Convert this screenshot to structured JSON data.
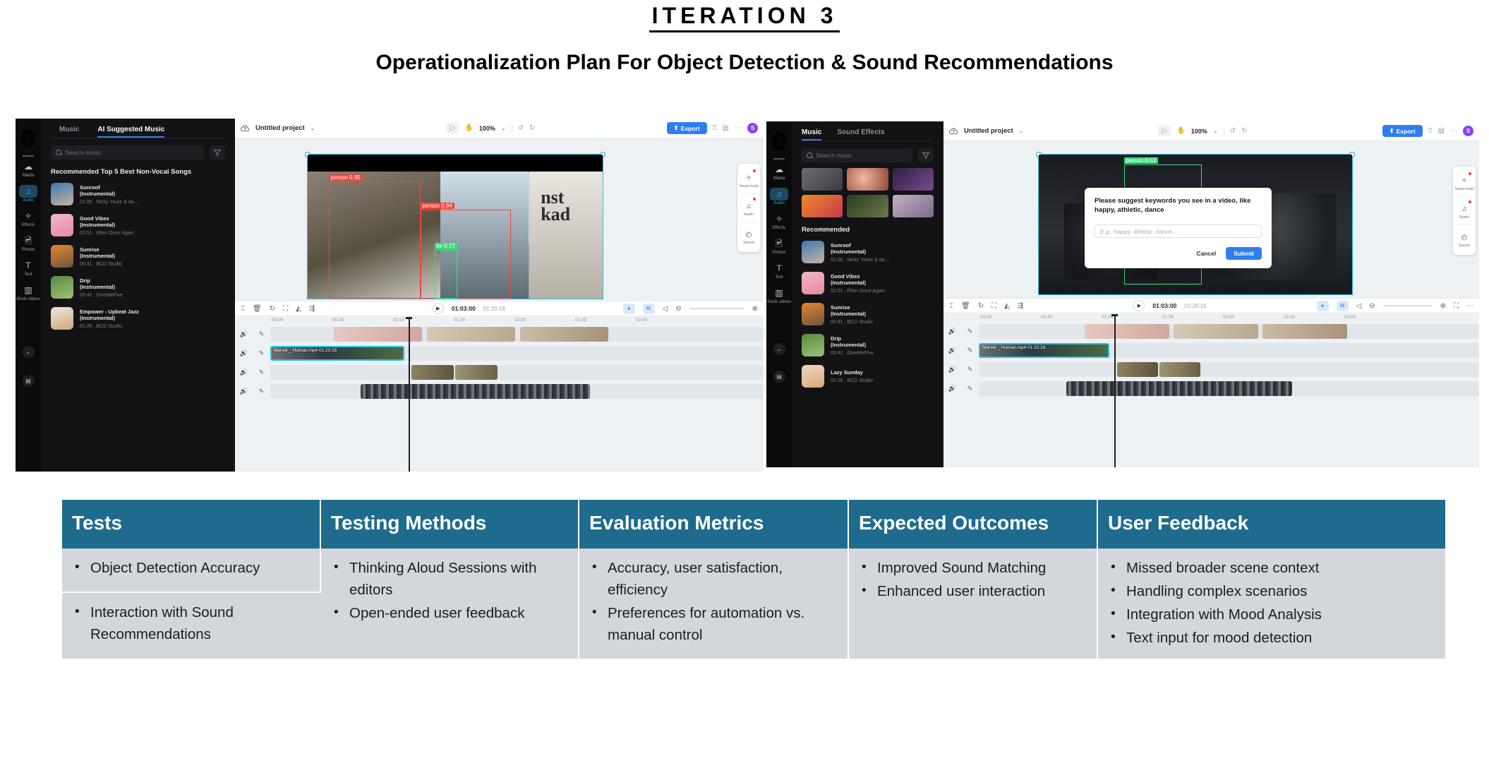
{
  "header": {
    "iteration_title": "ITERATION 3",
    "subtitle": "Operationalization Plan For Object Detection & Sound Recommendations"
  },
  "editor_left": {
    "nav": [
      {
        "label": "Media",
        "icon": "cloud-icon",
        "active": false
      },
      {
        "label": "Audio",
        "icon": "music-note-icon",
        "active": true
      },
      {
        "label": "Effects",
        "icon": "sparkle-icon",
        "active": false
      },
      {
        "label": "Photos",
        "icon": "image-icon",
        "active": false
      },
      {
        "label": "Text",
        "icon": "text-icon",
        "active": false
      },
      {
        "label": "Stock videos",
        "icon": "film-icon",
        "active": false
      }
    ],
    "tabs": [
      {
        "label": "Music",
        "active": false
      },
      {
        "label": "AI Suggested Music",
        "active": true
      }
    ],
    "search_placeholder": "Search music",
    "section_title": "Recommended Top 5 Best Non-Vocal Songs",
    "tracks": [
      {
        "title": "Sunroof (Instrumental)",
        "meta": "01:00 . Nicky Youre & da...",
        "c1": "#3f79b8",
        "c2": "#c7b49b"
      },
      {
        "title": "Good Vibes (Instrumental)",
        "meta": "02:51 . Ellen Once Again",
        "c1": "#f0b9c8",
        "c2": "#e5889f"
      },
      {
        "title": "Sunrise (Instrumental)",
        "meta": "00:31 . BCD Studio",
        "c1": "#e8872f",
        "c2": "#6b5440"
      },
      {
        "title": "Drip (Instrumental)",
        "meta": "00:42 . GiveMeFive",
        "c1": "#5c8a3f",
        "c2": "#9cc27a"
      },
      {
        "title": "Empower - Upbeat Jazz (Instrumental)",
        "meta": "01:26 . BCD Studio",
        "c1": "#efe6dc",
        "c2": "#cfa87e"
      }
    ],
    "header_bar": {
      "project_name": "Untitled project",
      "zoom": "100%",
      "export_label": "Export",
      "avatar_initial": "S"
    },
    "detections": [
      {
        "label": "person  0.95",
        "color": "#f2463a"
      },
      {
        "label": "person  0.94",
        "color": "#f2463a"
      },
      {
        "label": "tie  0.77",
        "color": "#3ddc7e"
      }
    ],
    "playbar": {
      "current": "01:03:00",
      "total": "01:20:16"
    },
    "ruler": [
      "00:00",
      "00:30",
      "01:00",
      "01:30",
      "02:00",
      "02:30",
      "03:00"
    ],
    "clip_label": "Marvel _ Human.mp4    01:20:16",
    "right_tools": [
      {
        "label": "Smart tools",
        "icon": "magic-wand-icon",
        "badge": true
      },
      {
        "label": "Audio",
        "icon": "music-note-icon",
        "badge": true
      },
      {
        "label": "Speed",
        "icon": "speedometer-icon",
        "badge": false
      }
    ]
  },
  "editor_right": {
    "nav": [
      {
        "label": "Media",
        "icon": "cloud-icon",
        "active": false
      },
      {
        "label": "Audio",
        "icon": "music-note-icon",
        "active": true
      },
      {
        "label": "Effects",
        "icon": "sparkle-icon",
        "active": false
      },
      {
        "label": "Photos",
        "icon": "image-icon",
        "active": false
      },
      {
        "label": "Text",
        "icon": "text-icon",
        "active": false
      },
      {
        "label": "Stock videos",
        "icon": "film-icon",
        "active": false
      }
    ],
    "tabs": [
      {
        "label": "Music",
        "active": true
      },
      {
        "label": "Sound Effects",
        "active": false
      }
    ],
    "search_placeholder": "Search music",
    "section_title": "Recommended",
    "tracks": [
      {
        "title": "Sunroof (Instrumental)",
        "meta": "01:00 . Nicky Youre & da...",
        "c1": "#3f79b8",
        "c2": "#c7b49b"
      },
      {
        "title": "Good Vibes (Instrumental)",
        "meta": "02:51 . Ellen Once Again",
        "c1": "#f0b9c8",
        "c2": "#e5889f"
      },
      {
        "title": "Sunrise (Instrumental)",
        "meta": "00:31 . BCD Studio",
        "c1": "#e8872f",
        "c2": "#6b5440"
      },
      {
        "title": "Drip (Instrumental)",
        "meta": "00:42 . GiveMeFive",
        "c1": "#5c8a3f",
        "c2": "#9cc27a"
      },
      {
        "title": "Lazy Sunday",
        "meta": "01:26 . BCD Studio",
        "c1": "#f0d8c0",
        "c2": "#d8a878"
      }
    ],
    "header_bar": {
      "project_name": "Untitled project",
      "zoom": "100%",
      "export_label": "Export",
      "avatar_initial": "S"
    },
    "detections": [
      {
        "label": "person  0.53",
        "color": "#3ddc7e"
      }
    ],
    "dialog": {
      "prompt": "Please suggest keywords you see in a video, like happy, athletic, dance",
      "input_placeholder": "E.g., happy, athletic, dance...",
      "cancel_label": "Cancel",
      "submit_label": "Submit"
    },
    "playbar": {
      "current": "01:03:00",
      "total": "01:20:16"
    },
    "ruler": [
      "00:00",
      "00:30",
      "01:00",
      "01:30",
      "02:00",
      "02:30",
      "03:00"
    ],
    "clip_label": "Marvel _ Human.mp4    01:20:16",
    "right_tools": [
      {
        "label": "Smart tools",
        "icon": "magic-wand-icon",
        "badge": true
      },
      {
        "label": "Audio",
        "icon": "music-note-icon",
        "badge": true
      },
      {
        "label": "Speed",
        "icon": "speedometer-icon",
        "badge": false
      }
    ]
  },
  "table": {
    "columns": [
      "Tests",
      "Testing Methods",
      "Evaluation Metrics",
      "Expected Outcomes",
      "User Feedback"
    ],
    "col1_rows": [
      [
        "Object Detection Accuracy"
      ],
      [
        "Interaction with Sound Recommendations"
      ]
    ],
    "col2": [
      "Thinking Aloud Sessions with editors",
      "Open-ended user feedback"
    ],
    "col3": [
      "Accuracy, user satisfaction, efficiency",
      "Preferences for automation vs. manual control"
    ],
    "col4": [
      "Improved Sound Matching",
      "Enhanced user interaction"
    ],
    "col5": [
      "Missed broader scene context",
      "Handling complex scenarios",
      "Integration with Mood Analysis",
      "Text input for mood detection"
    ]
  },
  "colors": {
    "header_teal": "#1f6b8e",
    "cell_gray": "#d3d7dc",
    "accent_blue": "#2f7ef0",
    "detect_red": "#f2463a",
    "detect_green": "#3ddc7e"
  }
}
